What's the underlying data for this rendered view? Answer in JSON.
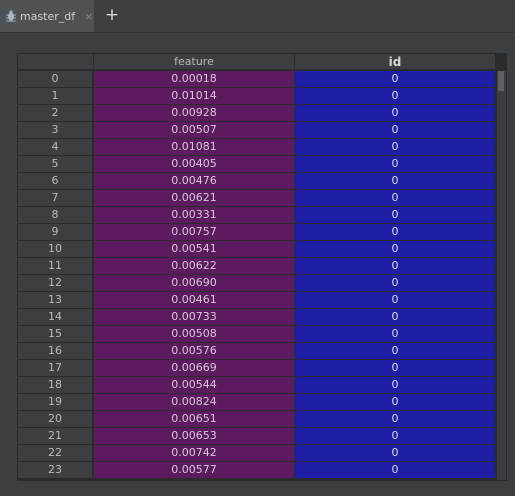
{
  "tab": {
    "label": "master_df",
    "close": "×",
    "add": "+"
  },
  "table": {
    "columns": [
      {
        "label": ""
      },
      {
        "label": "feature"
      },
      {
        "label": "id"
      }
    ],
    "rows": [
      {
        "index": "0",
        "feature": "0.00018",
        "id": "0"
      },
      {
        "index": "1",
        "feature": "0.01014",
        "id": "0"
      },
      {
        "index": "2",
        "feature": "0.00928",
        "id": "0"
      },
      {
        "index": "3",
        "feature": "0.00507",
        "id": "0"
      },
      {
        "index": "4",
        "feature": "0.01081",
        "id": "0"
      },
      {
        "index": "5",
        "feature": "0.00405",
        "id": "0"
      },
      {
        "index": "6",
        "feature": "0.00476",
        "id": "0"
      },
      {
        "index": "7",
        "feature": "0.00621",
        "id": "0"
      },
      {
        "index": "8",
        "feature": "0.00331",
        "id": "0"
      },
      {
        "index": "9",
        "feature": "0.00757",
        "id": "0"
      },
      {
        "index": "10",
        "feature": "0.00541",
        "id": "0"
      },
      {
        "index": "11",
        "feature": "0.00622",
        "id": "0"
      },
      {
        "index": "12",
        "feature": "0.00690",
        "id": "0"
      },
      {
        "index": "13",
        "feature": "0.00461",
        "id": "0"
      },
      {
        "index": "14",
        "feature": "0.00733",
        "id": "0"
      },
      {
        "index": "15",
        "feature": "0.00508",
        "id": "0"
      },
      {
        "index": "16",
        "feature": "0.00576",
        "id": "0"
      },
      {
        "index": "17",
        "feature": "0.00669",
        "id": "0"
      },
      {
        "index": "18",
        "feature": "0.00544",
        "id": "0"
      },
      {
        "index": "19",
        "feature": "0.00824",
        "id": "0"
      },
      {
        "index": "20",
        "feature": "0.00651",
        "id": "0"
      },
      {
        "index": "21",
        "feature": "0.00653",
        "id": "0"
      },
      {
        "index": "22",
        "feature": "0.00742",
        "id": "0"
      },
      {
        "index": "23",
        "feature": "0.00577",
        "id": "0"
      }
    ]
  },
  "colors": {
    "feature_column": "#5d1b5f",
    "id_column": "#1f1fa6",
    "header": "#3c3f41",
    "background": "#3c3f41"
  },
  "icons": {
    "tab": "dataframe-icon"
  }
}
